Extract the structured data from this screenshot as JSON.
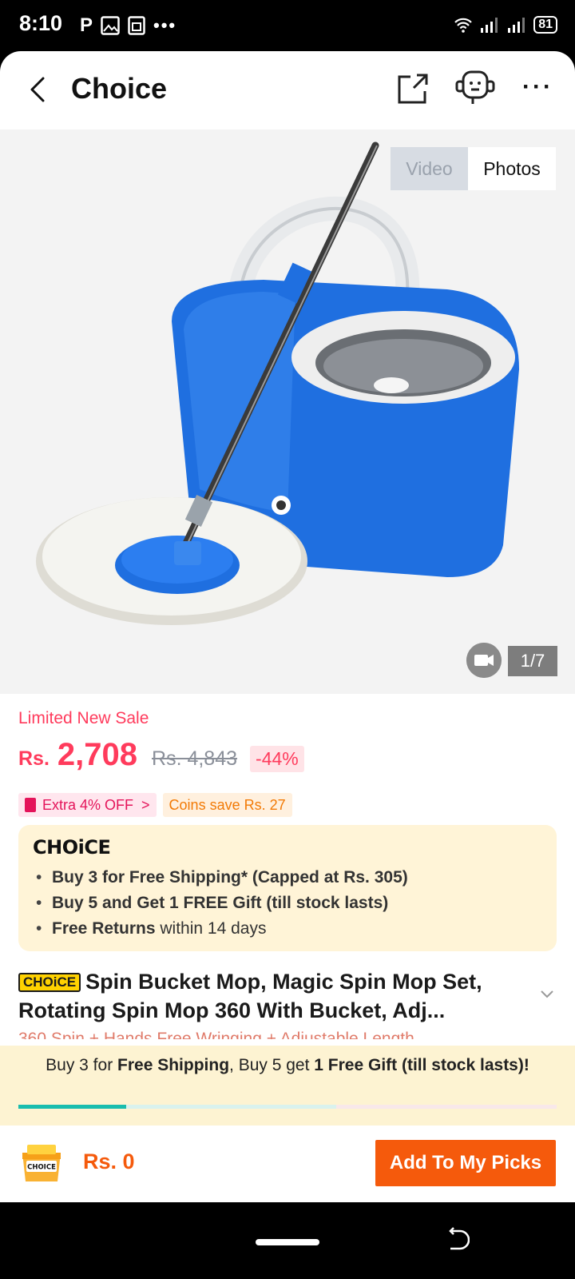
{
  "status_bar": {
    "time": "8:10",
    "left_icons": [
      "p-app-icon",
      "image-icon",
      "sim-icon",
      "more-dots-icon"
    ],
    "right_icons": [
      "wifi-icon",
      "signal-icon",
      "signal-icon",
      "battery-icon"
    ],
    "battery": "81"
  },
  "nav": {
    "title": "Choice",
    "icons": [
      "back-icon",
      "share-icon",
      "customer-service-icon",
      "more-icon"
    ],
    "more_label": "···"
  },
  "gallery": {
    "tabs": [
      {
        "label": "Video",
        "active": false
      },
      {
        "label": "Photos",
        "active": true
      }
    ],
    "counter": "1/7",
    "image_alt_icon": "spin-mop-bucket-product-image",
    "colors": {
      "bucket": "#1f6fe0",
      "mop_head": "#f4f4f0",
      "handle": "#3a3a3a"
    }
  },
  "price": {
    "sale_label": "Limited New Sale",
    "currency": "Rs.",
    "current": "2,708",
    "original": "Rs. 4,843",
    "discount": "-44%"
  },
  "promos": {
    "extra_off": "Extra 4% OFF",
    "extra_chevron": ">",
    "coins": "Coins save Rs. 27"
  },
  "choice_box": {
    "logo": "CHOiCE",
    "benefits": [
      {
        "bold": "Buy 3 for  Free Shipping* (Capped at Rs. 305)",
        "rest": ""
      },
      {
        "bold": "Buy 5 and Get 1 FREE Gift (till stock lasts)",
        "rest": ""
      },
      {
        "bold": "Free Returns",
        "rest": " within 14 days"
      }
    ]
  },
  "product": {
    "tag": "CHOiCE",
    "title": "Spin Bucket Mop, Magic Spin Mop Set, Rotating Spin Mop 360 With Bucket, Adj...",
    "subtitle_peek": "360 Spin + Hands Free Wringing + Adjustable Length"
  },
  "free_shipping": {
    "p1": "Buy 3 for ",
    "b1": "Free Shipping",
    "p2": ", Buy 5 get ",
    "b2": "1 Free Gift (till stock lasts)!",
    "progress": 0.2,
    "progress_mid": 0.59,
    "colors": {
      "fill": "#19bdae",
      "background": "#fdf3d2"
    }
  },
  "bottom_bar": {
    "cart_label": "CHOICE",
    "total": "Rs. 0",
    "add_button": "Add To My Picks",
    "accent": "#f55a0c"
  }
}
